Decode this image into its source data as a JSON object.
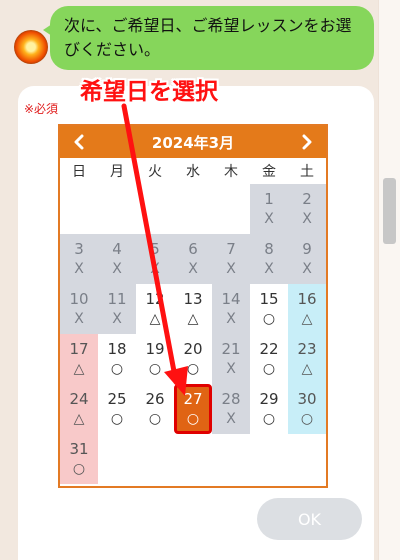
{
  "bubble": {
    "text": "次に、ご希望日、ご希望レッスンをお選びください。"
  },
  "form": {
    "required": "※必須"
  },
  "calendar": {
    "prev": "<",
    "next": ">",
    "title": "2024年3月",
    "weekdays": [
      "日",
      "月",
      "火",
      "水",
      "木",
      "金",
      "土"
    ],
    "weeks": [
      [
        {
          "day": "",
          "mark": "",
          "state": "empty"
        },
        {
          "day": "",
          "mark": "",
          "state": "empty"
        },
        {
          "day": "",
          "mark": "",
          "state": "empty"
        },
        {
          "day": "",
          "mark": "",
          "state": "empty"
        },
        {
          "day": "",
          "mark": "",
          "state": "empty"
        },
        {
          "day": "1",
          "mark": "X",
          "state": "closed"
        },
        {
          "day": "2",
          "mark": "X",
          "state": "closed"
        }
      ],
      [
        {
          "day": "3",
          "mark": "X",
          "state": "closed"
        },
        {
          "day": "4",
          "mark": "X",
          "state": "closed"
        },
        {
          "day": "5",
          "mark": "X",
          "state": "closed"
        },
        {
          "day": "6",
          "mark": "X",
          "state": "closed"
        },
        {
          "day": "7",
          "mark": "X",
          "state": "closed"
        },
        {
          "day": "8",
          "mark": "X",
          "state": "closed"
        },
        {
          "day": "9",
          "mark": "X",
          "state": "closed"
        }
      ],
      [
        {
          "day": "10",
          "mark": "X",
          "state": "closed"
        },
        {
          "day": "11",
          "mark": "X",
          "state": "closed"
        },
        {
          "day": "12",
          "mark": "△",
          "state": "open"
        },
        {
          "day": "13",
          "mark": "△",
          "state": "open"
        },
        {
          "day": "14",
          "mark": "X",
          "state": "closed"
        },
        {
          "day": "15",
          "mark": "○",
          "state": "open"
        },
        {
          "day": "16",
          "mark": "△",
          "state": "sat"
        }
      ],
      [
        {
          "day": "17",
          "mark": "△",
          "state": "sun"
        },
        {
          "day": "18",
          "mark": "○",
          "state": "open"
        },
        {
          "day": "19",
          "mark": "○",
          "state": "open"
        },
        {
          "day": "20",
          "mark": "○",
          "state": "open"
        },
        {
          "day": "21",
          "mark": "X",
          "state": "closed"
        },
        {
          "day": "22",
          "mark": "○",
          "state": "open"
        },
        {
          "day": "23",
          "mark": "△",
          "state": "sat"
        }
      ],
      [
        {
          "day": "24",
          "mark": "△",
          "state": "sun"
        },
        {
          "day": "25",
          "mark": "○",
          "state": "open"
        },
        {
          "day": "26",
          "mark": "○",
          "state": "open"
        },
        {
          "day": "27",
          "mark": "○",
          "state": "selected"
        },
        {
          "day": "28",
          "mark": "X",
          "state": "closed"
        },
        {
          "day": "29",
          "mark": "○",
          "state": "open"
        },
        {
          "day": "30",
          "mark": "○",
          "state": "sat"
        }
      ],
      [
        {
          "day": "31",
          "mark": "○",
          "state": "sun"
        },
        {
          "day": "",
          "mark": "",
          "state": "empty"
        },
        {
          "day": "",
          "mark": "",
          "state": "empty"
        },
        {
          "day": "",
          "mark": "",
          "state": "empty"
        },
        {
          "day": "",
          "mark": "",
          "state": "empty"
        },
        {
          "day": "",
          "mark": "",
          "state": "empty"
        },
        {
          "day": "",
          "mark": "",
          "state": "empty"
        }
      ]
    ]
  },
  "annotation": {
    "label": "希望日を選択"
  },
  "ok_button": {
    "label": "OK"
  },
  "colors": {
    "bubble": "#86d65b",
    "header": "#e47a1a",
    "closed": "#d5d8df",
    "sunday": "#f8c9c9",
    "saturday": "#c8eef8",
    "selected": "#e06414",
    "annotation": "#ff1111"
  },
  "icons": [
    "avatar-sun-icon",
    "chevron-left-icon",
    "chevron-right-icon"
  ]
}
